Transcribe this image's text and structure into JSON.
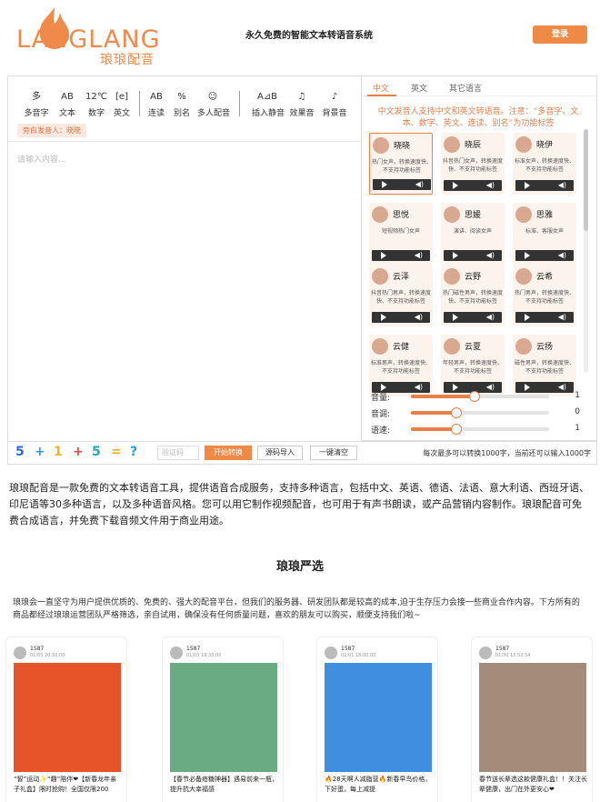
{
  "header": {
    "logo_text": "LANGLANG",
    "logo_cn": "琅琅配音",
    "slogan": "永久免费的智能文本转语音系统",
    "login_label": "登录"
  },
  "toolbar": {
    "tools": [
      {
        "icon": "多",
        "label": "多音字"
      },
      {
        "icon": "AB",
        "label": "文本"
      },
      {
        "icon": "12℃",
        "label": "数字"
      },
      {
        "icon": "[e]",
        "label": "英文"
      },
      {
        "icon": "AB",
        "label": "连读"
      },
      {
        "icon": "%",
        "label": "别名"
      },
      {
        "icon": "☺",
        "label": "多人配音"
      },
      {
        "icon": "A⊿B",
        "label": "插入静音"
      },
      {
        "icon": "♫",
        "label": "效果音"
      },
      {
        "icon": "♪",
        "label": "背景音"
      }
    ],
    "speaker_tag": "旁白发音人：晓晓"
  },
  "editor": {
    "placeholder": "请输入内容..."
  },
  "voice_panel": {
    "tabs": [
      "中文",
      "英文",
      "其它语言"
    ],
    "notice": "中文发音人支持中文和英文转语音。注意：“多音字、文本、数字、英文、连读、别名”为功能标签",
    "voices": [
      {
        "name": "晓晓",
        "desc": "热门女声，转换速度快、不支持功能标签",
        "selected": true
      },
      {
        "name": "晓辰",
        "desc": "抖音热门女声，转换速度快、不支持功能标签",
        "selected": false
      },
      {
        "name": "晓伊",
        "desc": "标准女声，转换速度快、不支持功能标签",
        "selected": false
      },
      {
        "name": "思悦",
        "desc": "短视频热门女声",
        "selected": false
      },
      {
        "name": "思媛",
        "desc": "演讲、阅读女声",
        "selected": false
      },
      {
        "name": "思雅",
        "desc": "标准、客服女声",
        "selected": false
      },
      {
        "name": "云泽",
        "desc": "抖音热门男声，转换速度快、不支持功能标签",
        "selected": false
      },
      {
        "name": "云野",
        "desc": "热门磁性男声，转换速度快、不支持功能标签",
        "selected": false
      },
      {
        "name": "云希",
        "desc": "热门男声，转换速度快、不支持功能标签",
        "selected": false
      },
      {
        "name": "云健",
        "desc": "标准男声，转换速度快、不支持功能标签",
        "selected": false
      },
      {
        "name": "云夏",
        "desc": "年轻男声，转换速度快、不支持功能标签",
        "selected": false
      },
      {
        "name": "云扬",
        "desc": "磁性男声，转换速度快、不支持功能标签",
        "selected": false
      }
    ],
    "sliders": [
      {
        "label": "音量:",
        "value": "1",
        "level": 0.46
      },
      {
        "label": "音调:",
        "value": "0",
        "level": 0.33
      },
      {
        "label": "语速:",
        "value": "1",
        "level": 0.33
      }
    ]
  },
  "actionbar": {
    "badges": [
      {
        "text": "5",
        "color": "#2c6fd6"
      },
      {
        "text": "+",
        "color": "#2c9be0"
      },
      {
        "text": "1",
        "color": "#f2b32a"
      },
      {
        "text": "+",
        "color": "#e04848"
      },
      {
        "text": "5",
        "color": "#23a7b2"
      },
      {
        "text": "=",
        "color": "#f2b32a"
      },
      {
        "text": "?",
        "color": "#2c9be0"
      }
    ],
    "code_placeholder": "验证码",
    "convert_label": "开始转换",
    "import_label": "源码导入",
    "clear_label": "一键清空",
    "limit_text": "每次最多可以转换1000字，当前还可以输入1000字"
  },
  "intro": "琅琅配音是一款免费的文本转语音工具，提供语音合成服务，支持多种语言，包括中文、英语、德语、法语、意大利语、西班牙语、印尼语等30多种语言，以及多种语音风格。您可以用它制作视频配音，也可用于有声书朗读，或产品营销内容制作。琅琅配音可免费合成语言，并免费下载音频文件用于商业用途。",
  "selection": {
    "title": "琅琅严选",
    "desc": "琅琅会一直坚守为用户提供优质的、免费的、强大的配音平台，但我们的服务器、研发团队都是较高的成本,迫于生存压力会接一些商业合作内容。下方所有的商品都经过琅琅运营团队严格筛选，亲自试用，确保没有任何质量问题，喜欢的朋友可以购买，顺便支持我们啦~"
  },
  "products": [
    {
      "id": "1587",
      "time": "01/05 20:30:00",
      "title": "“智”运动✨“趣”陪伴❤【新春龙年亲子礼盒】限时抢购！全国仅限200",
      "color": "#e6542a"
    },
    {
      "id": "1587",
      "time": "01/03 18:30:00",
      "title": "【春节必备疮糖神器】遇易前来一瓶，提升抗大幸福感",
      "color": "#6aab84"
    },
    {
      "id": "1587",
      "time": "02/01 18:00:00",
      "title": "🔥28天啊人减脂营🔥新春早鸟价格，下好蛋，每上减提",
      "color": "#3f8ee0"
    },
    {
      "id": "1587",
      "time": "01/30 13:52:54",
      "title": "春节送长辈选这款健康礼盒！！关注长辈健康，出门在外更安心❤",
      "color": "#a58c7a"
    }
  ]
}
